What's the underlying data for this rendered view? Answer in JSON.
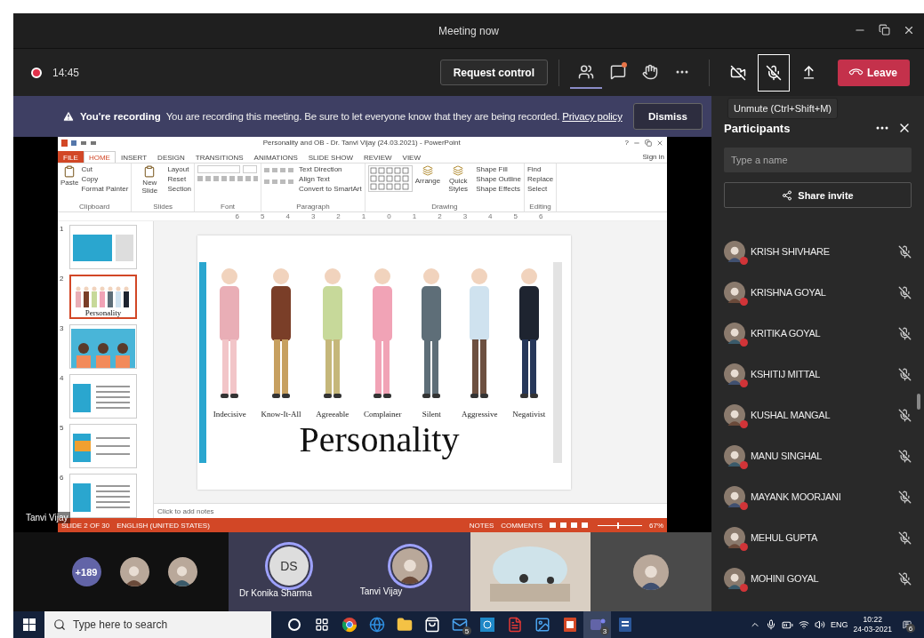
{
  "window": {
    "title": "Meeting now"
  },
  "toolbar": {
    "recording": true,
    "time": "14:45",
    "request_control": "Request control",
    "tools": [
      {
        "kind": "people",
        "selected": true,
        "unread": false
      },
      {
        "kind": "chat",
        "selected": false,
        "unread": true
      },
      {
        "kind": "reactions",
        "selected": false,
        "unread": false
      },
      {
        "kind": "more",
        "selected": false,
        "unread": false
      }
    ],
    "camera_on": false,
    "mic_on": false,
    "mic_focused": true,
    "leave": "Leave"
  },
  "tooltip": "Unmute (Ctrl+Shift+M)",
  "banner": {
    "title": "You're recording",
    "message": "You are recording this meeting. Be sure to let everyone know that they are being recorded.",
    "link": "Privacy policy",
    "button": "Dismiss"
  },
  "shared_screen": {
    "presenter": "Tanvi Vijay",
    "powerpoint": {
      "title": "Personality and OB - Dr. Tanvi Vijay (24.03.2021) - PowerPoint",
      "help": "?",
      "sign_in": "Sign in",
      "tabs": [
        {
          "label": "FILE",
          "kind": "file",
          "selected": false
        },
        {
          "label": "HOME",
          "kind": "tab",
          "selected": true
        },
        {
          "label": "INSERT",
          "kind": "tab",
          "selected": false
        },
        {
          "label": "DESIGN",
          "kind": "tab",
          "selected": false
        },
        {
          "label": "TRANSITIONS",
          "kind": "tab",
          "selected": false
        },
        {
          "label": "ANIMATIONS",
          "kind": "tab",
          "selected": false
        },
        {
          "label": "SLIDE SHOW",
          "kind": "tab",
          "selected": false
        },
        {
          "label": "REVIEW",
          "kind": "tab",
          "selected": false
        },
        {
          "label": "VIEW",
          "kind": "tab",
          "selected": false
        }
      ],
      "ribbon": [
        {
          "label": "Clipboard",
          "kind": "commands",
          "large": [
            "Paste"
          ],
          "small": [
            "Cut",
            "Copy",
            "Format Painter"
          ]
        },
        {
          "label": "Slides",
          "kind": "commands",
          "large": [
            "New Slide"
          ],
          "small": [
            "Layout",
            "Reset",
            "Section"
          ]
        },
        {
          "label": "Font",
          "kind": "font"
        },
        {
          "label": "Paragraph",
          "kind": "paragraph",
          "small": [
            "Text Direction",
            "Align Text",
            "Convert to SmartArt"
          ]
        },
        {
          "label": "Drawing",
          "kind": "drawing",
          "large": [
            "Arrange",
            "Quick Styles"
          ],
          "small": [
            "Shape Fill",
            "Shape Outline",
            "Shape Effects"
          ]
        },
        {
          "label": "Editing",
          "kind": "commands",
          "small": [
            "Find",
            "Replace",
            "Select"
          ]
        }
      ],
      "ruler": [
        "6",
        "5",
        "4",
        "3",
        "2",
        "1",
        "0",
        "1",
        "2",
        "3",
        "4",
        "5",
        "6"
      ],
      "thumbnails": [
        {
          "number": "1",
          "kind": "title",
          "selected": false
        },
        {
          "number": "2",
          "kind": "figures",
          "selected": true,
          "caption": "Personality"
        },
        {
          "number": "3",
          "kind": "cartoon",
          "selected": false
        },
        {
          "number": "4",
          "kind": "list",
          "selected": false
        },
        {
          "number": "5",
          "kind": "image",
          "selected": false
        },
        {
          "number": "6",
          "kind": "list",
          "selected": false
        }
      ],
      "slide": {
        "characters": [
          "Indecisive",
          "Know-It-All",
          "Agreeable",
          "Complainer",
          "Silent",
          "Aggressive",
          "Negativist"
        ],
        "title": "Personality"
      },
      "notes_placeholder": "Click to add notes",
      "status": {
        "slide": "SLIDE 2 OF 30",
        "language": "ENGLISH (UNITED STATES)",
        "notes": "NOTES",
        "comments": "COMMENTS",
        "zoom": "67%",
        "level": 0.45
      }
    }
  },
  "participants": {
    "title": "Participants",
    "search_placeholder": "Type a name",
    "share": "Share invite",
    "people": [
      {
        "name": "KRISH SHIVHARE",
        "muted": true
      },
      {
        "name": "KRISHNA GOYAL",
        "muted": true
      },
      {
        "name": "KRITIKA GOYAL",
        "muted": true
      },
      {
        "name": "KSHITIJ MITTAL",
        "muted": true
      },
      {
        "name": "KUSHAL MANGAL",
        "muted": true
      },
      {
        "name": "MANU SINGHAL",
        "muted": true
      },
      {
        "name": "MAYANK MOORJANI",
        "muted": true
      },
      {
        "name": "MEHUL GUPTA",
        "muted": true
      },
      {
        "name": "MOHINI GOYAL",
        "muted": true
      }
    ]
  },
  "video_strip": [
    {
      "kind": "overflow",
      "label": "+189",
      "speaking": false
    },
    {
      "kind": "avatar",
      "speaking": false
    },
    {
      "kind": "avatar",
      "speaking": false
    },
    {
      "kind": "initials",
      "initials": "DS",
      "name": "Dr Konika Sharma",
      "speaking": true
    },
    {
      "kind": "avatar",
      "name": "Tanvi Vijay",
      "speaking": true
    },
    {
      "kind": "video",
      "speaking": false
    },
    {
      "kind": "avatar",
      "speaking": false
    }
  ],
  "taskbar": {
    "search_placeholder": "Type here to search",
    "apps": [
      {
        "kind": "cortana",
        "selected": false
      },
      {
        "kind": "taskview",
        "selected": false
      },
      {
        "kind": "browser",
        "selected": false
      },
      {
        "kind": "edge",
        "selected": false
      },
      {
        "kind": "folder",
        "selected": false
      },
      {
        "kind": "store",
        "selected": false
      },
      {
        "kind": "mail",
        "selected": false,
        "badge": "5"
      },
      {
        "kind": "p",
        "selected": false
      },
      {
        "kind": "pdf",
        "selected": false
      },
      {
        "kind": "photos",
        "selected": false
      },
      {
        "kind": "slides",
        "selected": false
      },
      {
        "kind": "teams",
        "selected": true,
        "badge": "3"
      },
      {
        "kind": "word",
        "selected": false
      }
    ],
    "language": "ENG",
    "time": "10:22",
    "date": "24-03-2021",
    "notifications": "6"
  }
}
